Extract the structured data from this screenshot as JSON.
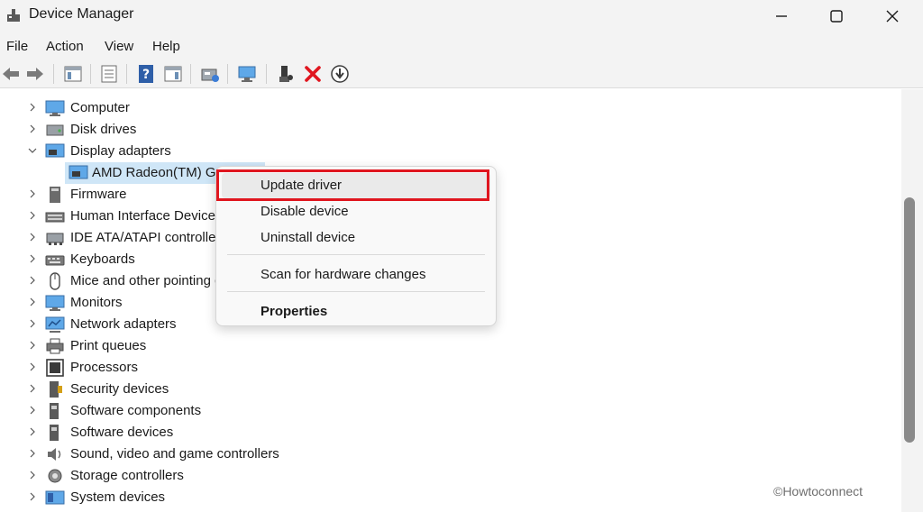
{
  "window": {
    "title": "Device Manager"
  },
  "menubar": {
    "items": [
      {
        "label": "File"
      },
      {
        "label": "Action"
      },
      {
        "label": "View"
      },
      {
        "label": "Help"
      }
    ]
  },
  "toolbar": {
    "buttons": [
      {
        "icon": "back-arrow-icon"
      },
      {
        "icon": "forward-arrow-icon"
      },
      {
        "icon": "show-hide-console-tree-icon"
      },
      {
        "icon": "properties-icon"
      },
      {
        "icon": "help-icon"
      },
      {
        "icon": "action-pane-icon"
      },
      {
        "icon": "update-driver-icon"
      },
      {
        "icon": "scan-hardware-icon"
      },
      {
        "icon": "enable-device-icon"
      },
      {
        "icon": "uninstall-device-icon"
      },
      {
        "icon": "disable-device-icon"
      }
    ]
  },
  "tree": {
    "nodes": [
      {
        "label": "Computer",
        "icon": "computer-icon",
        "expanded": false
      },
      {
        "label": "Disk drives",
        "icon": "disk-drive-icon",
        "expanded": false
      },
      {
        "label": "Display adapters",
        "icon": "display-adapter-icon",
        "expanded": true,
        "children": [
          {
            "label": "AMD Radeon(TM) Graphics",
            "icon": "display-adapter-icon",
            "selected": true
          }
        ]
      },
      {
        "label": "Firmware",
        "icon": "firmware-icon",
        "expanded": false
      },
      {
        "label": "Human Interface Devices",
        "icon": "hid-icon",
        "expanded": false
      },
      {
        "label": "IDE ATA/ATAPI controllers",
        "icon": "ide-controller-icon",
        "expanded": false
      },
      {
        "label": "Keyboards",
        "icon": "keyboard-icon",
        "expanded": false
      },
      {
        "label": "Mice and other pointing devices",
        "icon": "mouse-icon",
        "expanded": false
      },
      {
        "label": "Monitors",
        "icon": "monitor-icon",
        "expanded": false
      },
      {
        "label": "Network adapters",
        "icon": "network-adapter-icon",
        "expanded": false
      },
      {
        "label": "Print queues",
        "icon": "printer-icon",
        "expanded": false
      },
      {
        "label": "Processors",
        "icon": "processor-icon",
        "expanded": false
      },
      {
        "label": "Security devices",
        "icon": "security-device-icon",
        "expanded": false
      },
      {
        "label": "Software components",
        "icon": "software-component-icon",
        "expanded": false
      },
      {
        "label": "Software devices",
        "icon": "software-device-icon",
        "expanded": false
      },
      {
        "label": "Sound, video and game controllers",
        "icon": "sound-icon",
        "expanded": false
      },
      {
        "label": "Storage controllers",
        "icon": "storage-controller-icon",
        "expanded": false
      },
      {
        "label": "System devices",
        "icon": "system-device-icon",
        "expanded": false
      }
    ]
  },
  "context_menu": {
    "items": [
      {
        "label": "Update driver",
        "highlighted": true
      },
      {
        "label": "Disable device"
      },
      {
        "label": "Uninstall device"
      },
      {
        "label": "Scan for hardware changes"
      },
      {
        "label": "Properties",
        "bold": true
      }
    ]
  },
  "watermark": "©Howtoconnect",
  "colors": {
    "highlight_box": "#e0161f",
    "selection": "#cfe6f7",
    "chrome": "#f3f3f3"
  }
}
